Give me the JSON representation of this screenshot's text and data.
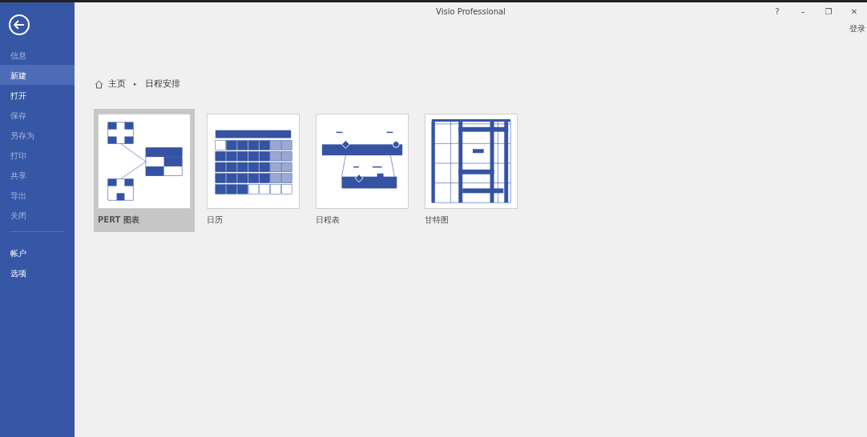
{
  "window": {
    "title": "Visio Professional",
    "controls": [
      "?",
      "–",
      "❐",
      "✕"
    ],
    "sign_in": "登录"
  },
  "sidebar": {
    "items": [
      {
        "label": "信息",
        "selected": false,
        "disabled": true
      },
      {
        "label": "新建",
        "selected": true,
        "disabled": false
      },
      {
        "label": "打开",
        "selected": false,
        "disabled": false
      },
      {
        "label": "保存",
        "selected": false,
        "disabled": true
      },
      {
        "label": "另存为",
        "selected": false,
        "disabled": true
      },
      {
        "label": "打印",
        "selected": false,
        "disabled": true
      },
      {
        "label": "共享",
        "selected": false,
        "disabled": true
      },
      {
        "label": "导出",
        "selected": false,
        "disabled": true
      },
      {
        "label": "关闭",
        "selected": false,
        "disabled": true
      }
    ],
    "bottom_items": [
      {
        "label": "帐户",
        "selected": false,
        "disabled": false
      },
      {
        "label": "选项",
        "selected": false,
        "disabled": false
      }
    ]
  },
  "breadcrumb": {
    "home": "主页",
    "separator": "▸",
    "current": "日程安排"
  },
  "templates": [
    {
      "kind": "pert",
      "label": "PERT 图表",
      "selected": true
    },
    {
      "kind": "calendar",
      "label": "日历",
      "selected": false
    },
    {
      "kind": "timeline",
      "label": "日程表",
      "selected": false
    },
    {
      "kind": "gantt",
      "label": "甘特图",
      "selected": false
    }
  ]
}
